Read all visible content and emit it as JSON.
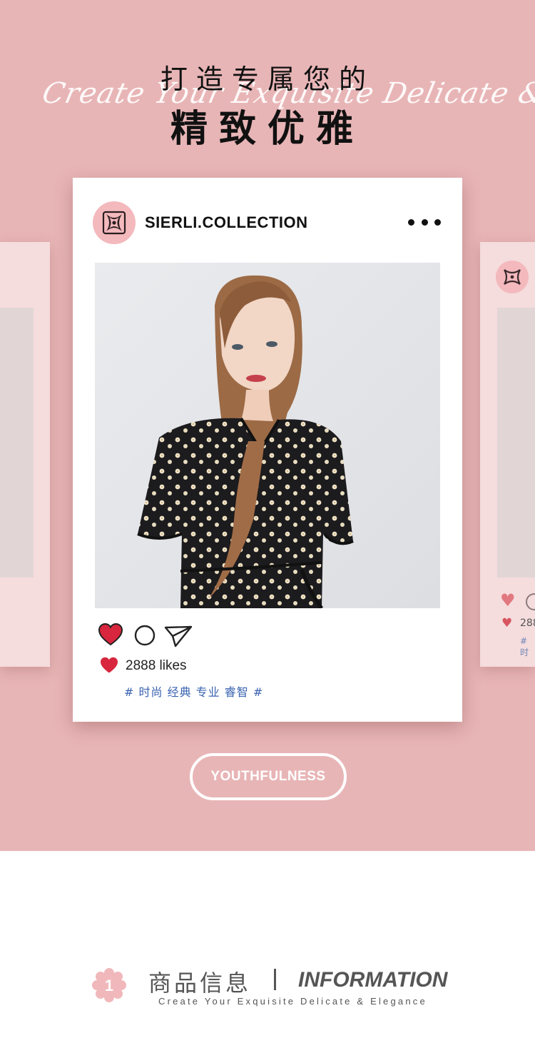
{
  "hero": {
    "title_line1": "打造专属您的",
    "title_line2": "精致优雅",
    "script_text": "Create Your Exquisite Delicate & Elegance"
  },
  "post": {
    "handle": "SIERLI.COLLECTION",
    "more_icon": "more-horizontal-icon",
    "likes_text": "2888 likes",
    "tags": "# 时尚 经典 专业 睿智 #",
    "heart_color": "#d7263d"
  },
  "side_post": {
    "likes_text": "288",
    "tags": "# 时"
  },
  "pill": {
    "label": "YOUTHFULNESS"
  },
  "info": {
    "number": "1",
    "cn_title": "商品信息",
    "en_title": "INFORMATION",
    "subtitle": "Create Your Exquisite Delicate & Elegance"
  },
  "colors": {
    "background_pink": "#e8b5b6",
    "accent_pink": "#f3b9bd",
    "tag_blue": "#3a63b0"
  }
}
